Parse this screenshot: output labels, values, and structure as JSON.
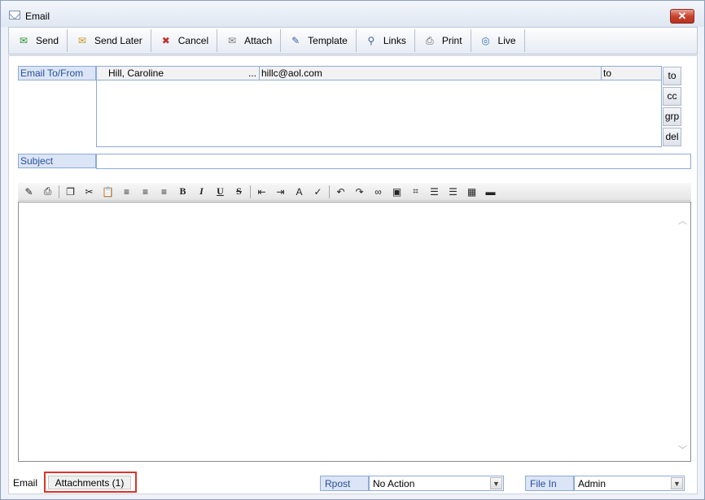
{
  "window": {
    "title": "Email",
    "close_label": "✕"
  },
  "toolbar": [
    {
      "name": "send",
      "label": "Send",
      "icon": "✉",
      "color": "#2e8b2e"
    },
    {
      "name": "send-later",
      "label": "Send Later",
      "icon": "✉",
      "color": "#c79a1b"
    },
    {
      "name": "cancel",
      "label": "Cancel",
      "icon": "✖",
      "color": "#c0312a"
    },
    {
      "name": "attach",
      "label": "Attach",
      "icon": "✉",
      "color": "#7a7a7a"
    },
    {
      "name": "template",
      "label": "Template",
      "icon": "✎",
      "color": "#3a5fa0"
    },
    {
      "name": "links",
      "label": "Links",
      "icon": "⚲",
      "color": "#3a5fa0"
    },
    {
      "name": "print",
      "label": "Print",
      "icon": "⎙",
      "color": "#555"
    },
    {
      "name": "live",
      "label": "Live",
      "icon": "◎",
      "color": "#3a6fb0"
    }
  ],
  "recipients": {
    "label": "Email To/From",
    "rows": [
      {
        "name": "Hill, Caroline",
        "more": "...",
        "email": "hillc@aol.com",
        "type": "to"
      }
    ],
    "side_buttons": [
      "to",
      "cc",
      "grp",
      "del"
    ]
  },
  "subject": {
    "label": "Subject",
    "value": ""
  },
  "format_toolbar": {
    "groups": [
      [
        {
          "icon": "eraser-icon",
          "glyph": "✎"
        },
        {
          "icon": "print-icon",
          "glyph": "⎙"
        }
      ],
      [
        {
          "icon": "copy-icon",
          "glyph": "❐"
        },
        {
          "icon": "cut-icon",
          "glyph": "✂"
        },
        {
          "icon": "paste-icon",
          "glyph": "📋"
        },
        {
          "icon": "align-left-icon",
          "glyph": "≡"
        },
        {
          "icon": "align-center-icon",
          "glyph": "≡"
        },
        {
          "icon": "align-right-icon",
          "glyph": "≡"
        },
        {
          "icon": "bold-icon",
          "glyph": "B",
          "cls": "b"
        },
        {
          "icon": "italic-icon",
          "glyph": "I",
          "cls": "i"
        },
        {
          "icon": "underline-icon",
          "glyph": "U",
          "cls": "u"
        },
        {
          "icon": "strikethrough-icon",
          "glyph": "S",
          "cls": "s"
        }
      ],
      [
        {
          "icon": "outdent-icon",
          "glyph": "⇤"
        },
        {
          "icon": "indent-icon",
          "glyph": "⇥"
        },
        {
          "icon": "font-color-icon",
          "glyph": "A"
        },
        {
          "icon": "spellcheck-icon",
          "glyph": "✓"
        }
      ],
      [
        {
          "icon": "undo-icon",
          "glyph": "↶"
        },
        {
          "icon": "redo-icon",
          "glyph": "↷"
        },
        {
          "icon": "link-icon",
          "glyph": "∞"
        },
        {
          "icon": "image-icon",
          "glyph": "▣"
        },
        {
          "icon": "crop-icon",
          "glyph": "⌗"
        },
        {
          "icon": "ordered-list-icon",
          "glyph": "☰"
        },
        {
          "icon": "bullet-list-icon",
          "glyph": "☰"
        },
        {
          "icon": "table-icon",
          "glyph": "▦"
        },
        {
          "icon": "horizontal-rule-icon",
          "glyph": "▬"
        }
      ]
    ]
  },
  "editor": {
    "scroll_up": "︿",
    "scroll_down": "﹀"
  },
  "bottom": {
    "tab_email": "Email",
    "tab_attachments": "Attachments (1)",
    "rpost_label": "Rpost",
    "rpost_value": "No Action",
    "filein_label": "File In",
    "filein_value": "Admin",
    "dropdown_arrow": "▼"
  }
}
